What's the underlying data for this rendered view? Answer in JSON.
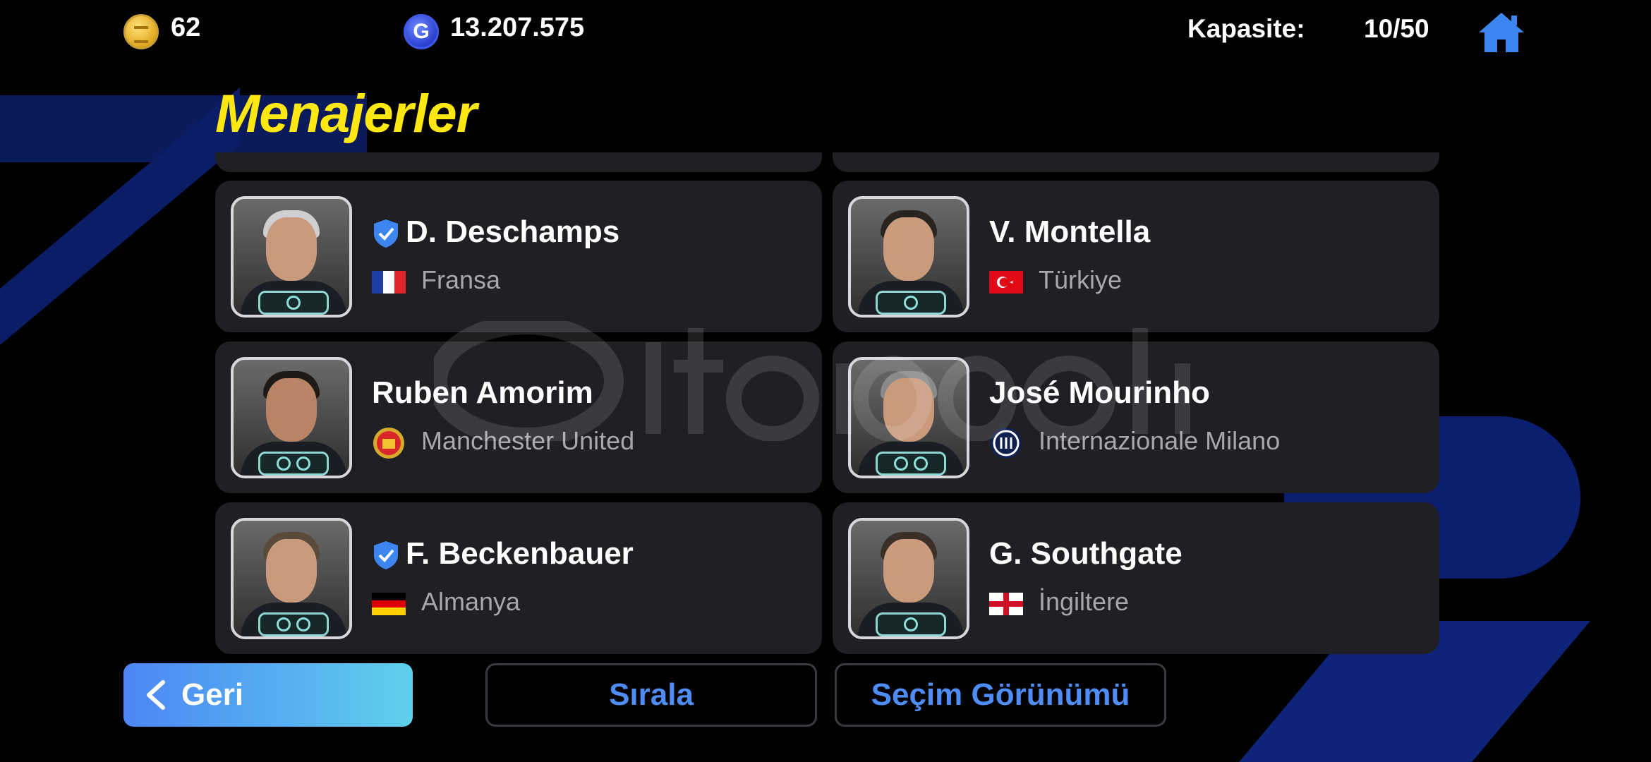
{
  "topbar": {
    "coins": "62",
    "gp": "13.207.575",
    "gp_icon_letter": "G",
    "capacity_label": "Kapasite:",
    "capacity_value": "10/50"
  },
  "page_title": "Menajerler",
  "managers": [
    {
      "name": "D. Deschamps",
      "team": "Fransa",
      "verified": true,
      "emblem": "france-flag-icon",
      "badges": 1
    },
    {
      "name": "V. Montella",
      "team": "Türkiye",
      "verified": false,
      "emblem": "turkey-flag-icon",
      "badges": 1
    },
    {
      "name": "Ruben Amorim",
      "team": "Manchester United",
      "verified": false,
      "emblem": "manchester-united-crest-icon",
      "badges": 2
    },
    {
      "name": "José Mourinho",
      "team": "Internazionale Milano",
      "verified": false,
      "emblem": "inter-milan-crest-icon",
      "badges": 2
    },
    {
      "name": "F. Beckenbauer",
      "team": "Almanya",
      "verified": true,
      "emblem": "germany-flag-icon",
      "badges": 2
    },
    {
      "name": "G. Southgate",
      "team": "İngiltere",
      "verified": false,
      "emblem": "england-flag-icon",
      "badges": 1
    }
  ],
  "buttons": {
    "back": "Geri",
    "sort": "Sırala",
    "selection_view": "Seçim Görünümü"
  },
  "colors": {
    "title": "#ffe712",
    "card_bg": "#1f1f24",
    "accent_blue": "#4e8cf6",
    "subtext": "#a7a7ad"
  }
}
